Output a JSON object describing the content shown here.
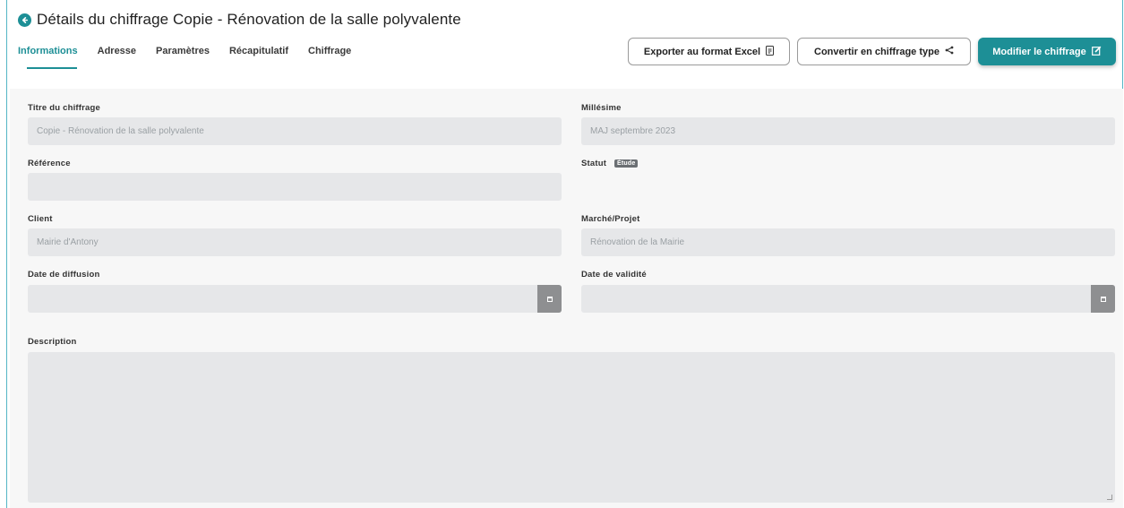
{
  "header": {
    "title": "Détails du chiffrage Copie - Rénovation de la salle polyvalente",
    "back_icon": "arrow-left-circle-icon"
  },
  "tabs": [
    {
      "label": "Informations",
      "active": true
    },
    {
      "label": "Adresse",
      "active": false
    },
    {
      "label": "Paramètres",
      "active": false
    },
    {
      "label": "Récapitulatif",
      "active": false
    },
    {
      "label": "Chiffrage",
      "active": false
    }
  ],
  "toolbar": {
    "export_label": "Exporter au format Excel",
    "export_icon": "file-excel-icon",
    "convert_label": "Convertir en chiffrage type",
    "convert_icon": "share-icon",
    "edit_label": "Modifier le chiffrage",
    "edit_icon": "edit-icon"
  },
  "form": {
    "titre": {
      "label": "Titre du chiffrage",
      "value": "Copie - Rénovation de la salle polyvalente"
    },
    "millesime": {
      "label": "Millésime",
      "value": "MAJ septembre 2023"
    },
    "reference": {
      "label": "Référence",
      "value": ""
    },
    "statut": {
      "label": "Statut",
      "badge": "Étude"
    },
    "client": {
      "label": "Client",
      "value": "Mairie d'Antony"
    },
    "marche": {
      "label": "Marché/Projet",
      "value": "Rénovation de la Mairie"
    },
    "date_diffusion": {
      "label": "Date de diffusion",
      "value": ""
    },
    "date_validite": {
      "label": "Date de validité",
      "value": ""
    },
    "description": {
      "label": "Description",
      "value": ""
    }
  },
  "colors": {
    "accent": "#1d8f96",
    "field_bg": "#e6e7e9",
    "content_bg": "#f7f7f7"
  }
}
